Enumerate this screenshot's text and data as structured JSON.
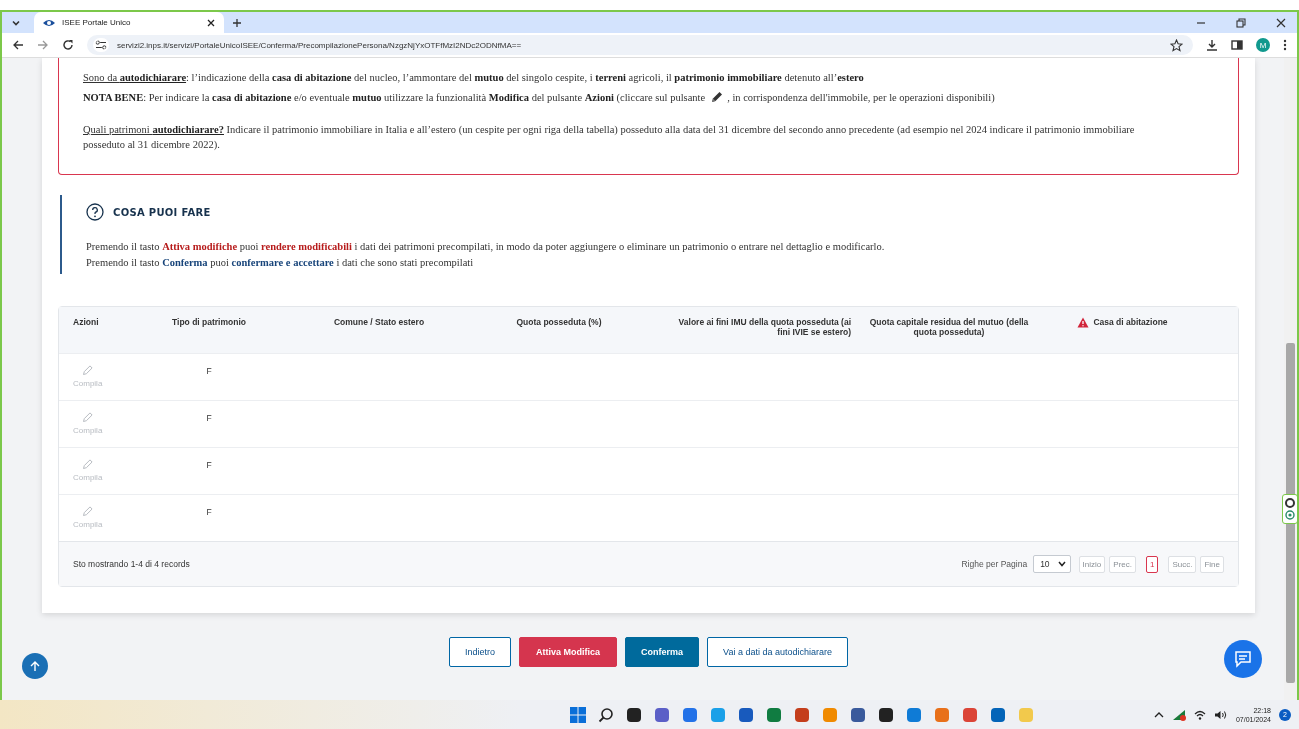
{
  "browser": {
    "tab_title": "ISEE Portale Unico",
    "url": "servizi2.inps.it/servizi/PortaleUnicoISEE/Conferma/PrecompilazionePersona/NzgzNjYxOTFfMzI2NDc2ODNfMA==",
    "profile_initial": "M"
  },
  "notice": {
    "paragraphs": [
      {
        "lines": [
          {
            "parts": [
              {
                "kind": "text",
                "runs": [
                  {
                    "t": "Sono da ",
                    "bold": false,
                    "underline": true
                  },
                  {
                    "t": "autodichiarare",
                    "bold": true,
                    "underline": true
                  },
                  {
                    "t": ": l’indicazione della ",
                    "bold": false,
                    "underline": false
                  },
                  {
                    "t": "casa di abitazione",
                    "bold": true,
                    "underline": false
                  },
                  {
                    "t": " del nucleo, l’ammontare del ",
                    "bold": false,
                    "underline": false
                  },
                  {
                    "t": "mutuo",
                    "bold": true,
                    "underline": false
                  },
                  {
                    "t": " del singolo cespite, i ",
                    "bold": false,
                    "underline": false
                  },
                  {
                    "t": "terreni",
                    "bold": true,
                    "underline": false
                  },
                  {
                    "t": " agricoli, il ",
                    "bold": false,
                    "underline": false
                  },
                  {
                    "t": "patrimonio immobiliare",
                    "bold": true,
                    "underline": false
                  },
                  {
                    "t": " detenuto all’",
                    "bold": false,
                    "underline": false
                  },
                  {
                    "t": "estero",
                    "bold": true,
                    "underline": false
                  }
                ]
              }
            ]
          },
          {
            "parts": [
              {
                "kind": "text",
                "runs": [
                  {
                    "t": "NOTA BENE",
                    "bold": true,
                    "underline": false
                  },
                  {
                    "t": ": Per indicare la ",
                    "bold": false,
                    "underline": false
                  },
                  {
                    "t": "casa di abitazione",
                    "bold": true,
                    "underline": false
                  },
                  {
                    "t": " e/o eventuale ",
                    "bold": false,
                    "underline": false
                  },
                  {
                    "t": "mutuo",
                    "bold": true,
                    "underline": false
                  },
                  {
                    "t": " utilizzare la funzionalità ",
                    "bold": false,
                    "underline": false
                  },
                  {
                    "t": "Modifica",
                    "bold": true,
                    "underline": false
                  },
                  {
                    "t": " del pulsante ",
                    "bold": false,
                    "underline": false
                  },
                  {
                    "t": "Azioni",
                    "bold": true,
                    "underline": false
                  },
                  {
                    "t": " (cliccare sul pulsante",
                    "bold": false,
                    "underline": false
                  }
                ]
              },
              {
                "kind": "pencil"
              },
              {
                "kind": "text",
                "runs": [
                  {
                    "t": ", in corrispondenza dell'immobile, per le operazioni disponibili)",
                    "bold": false,
                    "underline": false
                  }
                ]
              }
            ]
          }
        ]
      },
      {
        "lines": [
          {
            "parts": [
              {
                "kind": "text",
                "runs": [
                  {
                    "t": "Quali patrimoni ",
                    "bold": false,
                    "underline": true
                  },
                  {
                    "t": "autodichiarare?",
                    "bold": true,
                    "underline": true
                  },
                  {
                    "t": " Indicare il patrimonio immobiliare in Italia e all’estero (un cespite per ogni riga della tabella) posseduto alla data del 31 dicembre del secondo anno precedente (ad esempio nel 2024 indicare il patrimonio immobiliare posseduto al 31 dicembre 2022).",
                    "bold": false,
                    "underline": false
                  }
                ]
              }
            ]
          }
        ]
      }
    ]
  },
  "section": {
    "title": "COSA PUOI FARE",
    "lines": [
      {
        "parts": [
          {
            "kind": "text",
            "runs": [
              {
                "t": "Premendo il tasto ",
                "bold": false,
                "alert": false,
                "accent": false
              },
              {
                "t": "Attiva modifiche",
                "bold": true,
                "alert": true,
                "accent": false
              },
              {
                "t": " puoi ",
                "bold": false,
                "alert": false,
                "accent": false
              },
              {
                "t": "rendere modificabili",
                "bold": true,
                "alert": true,
                "accent": false
              },
              {
                "t": " i dati dei patrimoni precompilati, in modo da poter aggiungere o eliminare un patrimonio o entrare nel dettaglio e modificarlo.",
                "bold": false,
                "alert": false,
                "accent": false
              }
            ]
          }
        ]
      },
      {
        "parts": [
          {
            "kind": "text",
            "runs": [
              {
                "t": "Premendo il tasto ",
                "bold": false,
                "alert": false,
                "accent": false
              },
              {
                "t": "Conferma",
                "bold": true,
                "alert": false,
                "accent": true
              },
              {
                "t": " puoi ",
                "bold": false,
                "alert": false,
                "accent": false
              },
              {
                "t": "confermare e accettare",
                "bold": true,
                "alert": false,
                "accent": true
              },
              {
                "t": " i dati che sono stati precompilati",
                "bold": false,
                "alert": false,
                "accent": false
              }
            ]
          }
        ]
      }
    ]
  },
  "table": {
    "columns": [
      {
        "label": "Azioni",
        "warning": false
      },
      {
        "label": "Tipo di patrimonio",
        "warning": false
      },
      {
        "label": "Comune / Stato estero",
        "warning": false
      },
      {
        "label": "Quota posseduta (%)",
        "warning": false
      },
      {
        "label": "Valore ai fini IMU della quota posseduta (ai fini IVIE se estero)",
        "warning": false
      },
      {
        "label": "Quota capitale residua del mutuo (della quota posseduta)",
        "warning": false
      },
      {
        "label": "Casa di abitazione",
        "warning": true
      }
    ],
    "rows": [
      {
        "action": {
          "label": "Compila",
          "disabled": true
        },
        "type": "F"
      },
      {
        "action": {
          "label": "Compila",
          "disabled": true
        },
        "type": "F"
      },
      {
        "action": {
          "label": "Compila",
          "disabled": true
        },
        "type": "F"
      },
      {
        "action": {
          "label": "Compila",
          "disabled": true
        },
        "type": "F"
      }
    ],
    "footer": {
      "summary": "Sto mostrando 1-4 di 4 records",
      "rows_per_page_label": "Righe per Pagina",
      "rows_per_page": "10",
      "pages": [
        {
          "label": "Inizio",
          "disabled": true,
          "selected": false
        },
        {
          "label": "Prec.",
          "disabled": true,
          "selected": false
        },
        {
          "label": "1",
          "disabled": false,
          "selected": true
        },
        {
          "label": "Succ.",
          "disabled": true,
          "selected": false
        },
        {
          "label": "Fine",
          "disabled": true,
          "selected": false
        }
      ]
    }
  },
  "buttons": [
    {
      "label": "Indietro",
      "kind": "outline"
    },
    {
      "label": "Attiva Modifica",
      "kind": "danger"
    },
    {
      "label": "Conferma",
      "kind": "primary"
    },
    {
      "label": "Vai a dati da autodichiarare",
      "kind": "outline"
    }
  ],
  "taskbar": {
    "time": "22:18",
    "date": "07/01/2024",
    "notifications": "2"
  }
}
